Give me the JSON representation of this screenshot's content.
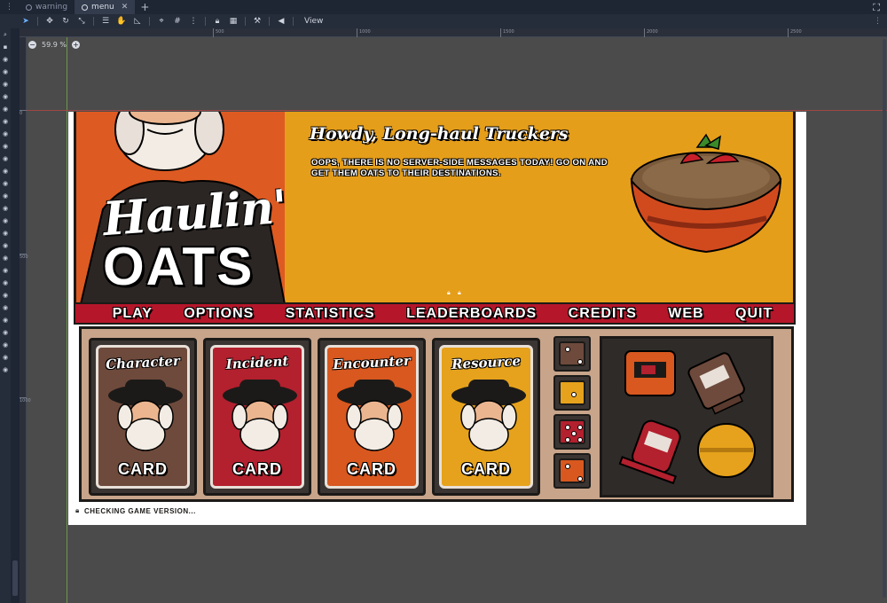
{
  "editor": {
    "tabs": [
      {
        "label": "warning",
        "active": false
      },
      {
        "label": "menu",
        "active": true
      }
    ],
    "toolbar": {
      "view_label": "View"
    },
    "zoom": "59.9 %",
    "ruler": {
      "marks": [
        "500",
        "1000",
        "1500",
        "2000",
        "2500"
      ],
      "vmarks": [
        "0",
        "500",
        "1000"
      ]
    }
  },
  "game": {
    "logo": {
      "line1": "Haulin'",
      "line2": "OATS"
    },
    "motd": {
      "title": "Howdy, Long-haul Truckers",
      "body": "Oops, there is no server-side messages today!  Go on and get them oats to their destinations."
    },
    "menu": [
      "PLAY",
      "OPTIONS",
      "STATISTICS",
      "LEADERBOARDS",
      "CREDITS",
      "WEB",
      "QUIT"
    ],
    "cards": [
      {
        "title": "Character",
        "sub": "CARD",
        "color": "#6e4a3c"
      },
      {
        "title": "Incident",
        "sub": "CARD",
        "color": "#b3202e"
      },
      {
        "title": "Encounter",
        "sub": "CARD",
        "color": "#d8581f"
      },
      {
        "title": "Resource",
        "sub": "CARD",
        "color": "#e6a21c"
      }
    ],
    "dice": [
      {
        "color": "#6e4a3c",
        "face": 2
      },
      {
        "color": "#e6a21c",
        "face": 1
      },
      {
        "color": "#b3202e",
        "face": 5
      },
      {
        "color": "#d8581f",
        "face": 2
      }
    ],
    "status": "Checking game version..."
  },
  "colors": {
    "banner": "#e59e1a",
    "accent_red": "#b5162a",
    "tray": "#c8a48a"
  }
}
